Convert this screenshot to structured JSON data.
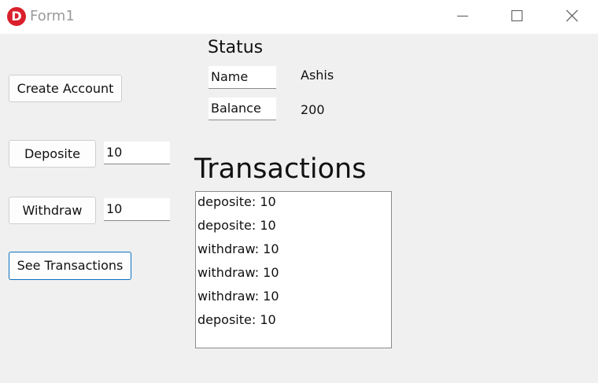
{
  "window": {
    "title": "Form1",
    "icon_letter": "D",
    "controls": [
      "minimize-icon",
      "maximize-icon",
      "close-icon"
    ]
  },
  "buttons": {
    "create_account": "Create Account",
    "deposite": "Deposite",
    "withdraw": "Withdraw",
    "see_transactions": "See Transactions"
  },
  "inputs": {
    "deposite_amount": "10",
    "withdraw_amount": "10"
  },
  "status": {
    "heading": "Status",
    "name_label": "Name",
    "name_value": "Ashis",
    "balance_label": "Balance",
    "balance_value": "200"
  },
  "transactions": {
    "heading": "Transactions",
    "items": [
      "deposite: 10",
      "deposite: 10",
      "withdraw: 10",
      "withdraw: 10",
      "withdraw: 10",
      "deposite: 10"
    ]
  },
  "colors": {
    "window_bg": "#f0f0f0",
    "titlebar_bg": "#ffffff",
    "icon_red": "#d9202c",
    "focus_border": "#0b6fbf"
  }
}
